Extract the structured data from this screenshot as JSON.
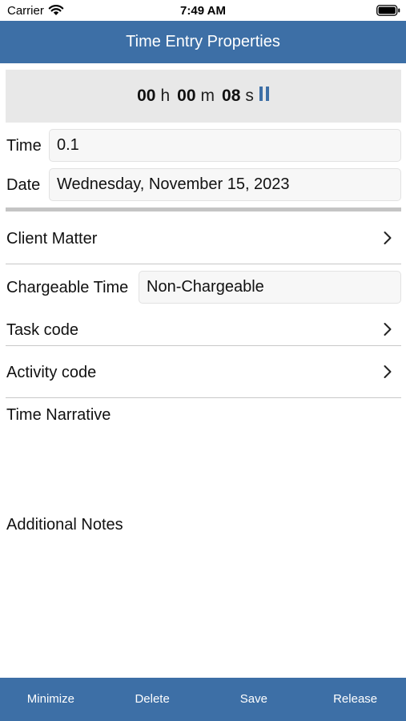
{
  "status_bar": {
    "carrier": "Carrier",
    "time": "7:49 AM"
  },
  "nav": {
    "title": "Time Entry Properties"
  },
  "timer": {
    "hours": "00",
    "hours_unit": "h",
    "minutes": "00",
    "minutes_unit": "m",
    "seconds": "08",
    "seconds_unit": "s",
    "icon": "pause-icon"
  },
  "form": {
    "time_label": "Time",
    "time_value": "0.1",
    "date_label": "Date",
    "date_value": "Wednesday, November 15, 2023",
    "client_matter_label": "Client Matter",
    "chargeable_label": "Chargeable Time",
    "chargeable_value": "Non-Chargeable",
    "task_code_label": "Task code",
    "activity_code_label": "Activity code",
    "time_narrative_label": "Time Narrative",
    "additional_notes_label": "Additional Notes"
  },
  "tab_bar": {
    "minimize": "Minimize",
    "delete": "Delete",
    "save": "Save",
    "release": "Release"
  },
  "colors": {
    "accent": "#3d6fa6",
    "timer_background": "#e8e8e8"
  }
}
